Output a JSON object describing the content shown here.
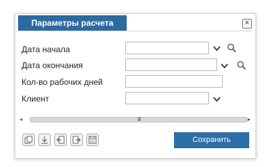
{
  "dialog": {
    "title": "Параметры расчета",
    "close_glyph": "×"
  },
  "form": {
    "start_date_label": "Дата начала",
    "start_date_value": "",
    "end_date_label": "Дата окончания",
    "end_date_value": "",
    "workdays_label": "Кол-во рабочих дней",
    "workdays_value": "",
    "client_label": "Клиент",
    "client_value": ""
  },
  "scrollbar": {
    "grip": "III",
    "left_arrow": "◂",
    "right_arrow": "▸"
  },
  "toolbar": {
    "icons": [
      "copy-icon",
      "download-icon",
      "import-icon",
      "export-icon",
      "save-disk-icon"
    ]
  },
  "actions": {
    "save_label": "Сохранить"
  },
  "colors": {
    "accent": "#2c6aa0",
    "button": "#2e6ea6"
  }
}
